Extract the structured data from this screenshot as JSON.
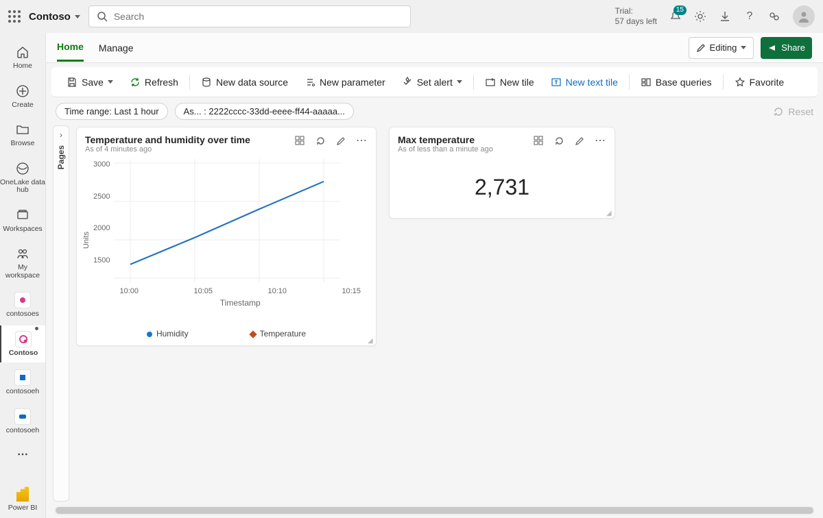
{
  "header": {
    "brand": "Contoso",
    "search_placeholder": "Search",
    "trial_label": "Trial:",
    "trial_remaining": "57 days left",
    "notif_count": "15"
  },
  "sidenav": {
    "items": [
      {
        "label": "Home"
      },
      {
        "label": "Create"
      },
      {
        "label": "Browse"
      },
      {
        "label": "OneLake data hub"
      },
      {
        "label": "Workspaces"
      },
      {
        "label": "My workspace"
      },
      {
        "label": "contosoes"
      },
      {
        "label": "Contoso"
      },
      {
        "label": "contosoeh"
      },
      {
        "label": "contosoeh"
      },
      {
        "label": "Power BI"
      }
    ]
  },
  "tabs": {
    "home": "Home",
    "manage": "Manage",
    "editing": "Editing",
    "share": "Share"
  },
  "toolbar": {
    "save": "Save",
    "refresh": "Refresh",
    "new_ds": "New data source",
    "new_param": "New parameter",
    "set_alert": "Set alert",
    "new_tile": "New tile",
    "new_text_tile": "New text tile",
    "base_queries": "Base queries",
    "favorite": "Favorite"
  },
  "chips": {
    "time_range": "Time range: Last 1 hour",
    "filter": "As... : 2222cccc-33dd-eeee-ff44-aaaaa...",
    "reset": "Reset"
  },
  "pages_rail": "Pages",
  "tile1": {
    "title": "Temperature and humidity over time",
    "subtitle": "As of 4 minutes ago",
    "legend": {
      "a": "Humidity",
      "b": "Temperature"
    }
  },
  "tile2": {
    "title": "Max temperature",
    "subtitle": "As of less than a minute ago",
    "value": "2,731"
  },
  "chart_data": {
    "type": "line",
    "title": "Temperature and humidity over time",
    "xlabel": "Timestamp",
    "ylabel": "Units",
    "x_ticks": [
      "10:00",
      "10:05",
      "10:10",
      "10:15"
    ],
    "y_ticks": [
      1500,
      2000,
      2500,
      3000
    ],
    "ylim": [
      1500,
      3000
    ],
    "series": [
      {
        "name": "Temperature",
        "color": "#c8491f",
        "x": [
          "10:00",
          "10:05",
          "10:10",
          "10:15"
        ],
        "values": [
          1680,
          2030,
          2400,
          2760
        ]
      },
      {
        "name": "Humidity",
        "color": "#1976d2",
        "x": [
          "10:00",
          "10:05",
          "10:10",
          "10:15"
        ],
        "values": [
          1680,
          2030,
          2400,
          2760
        ]
      }
    ]
  }
}
